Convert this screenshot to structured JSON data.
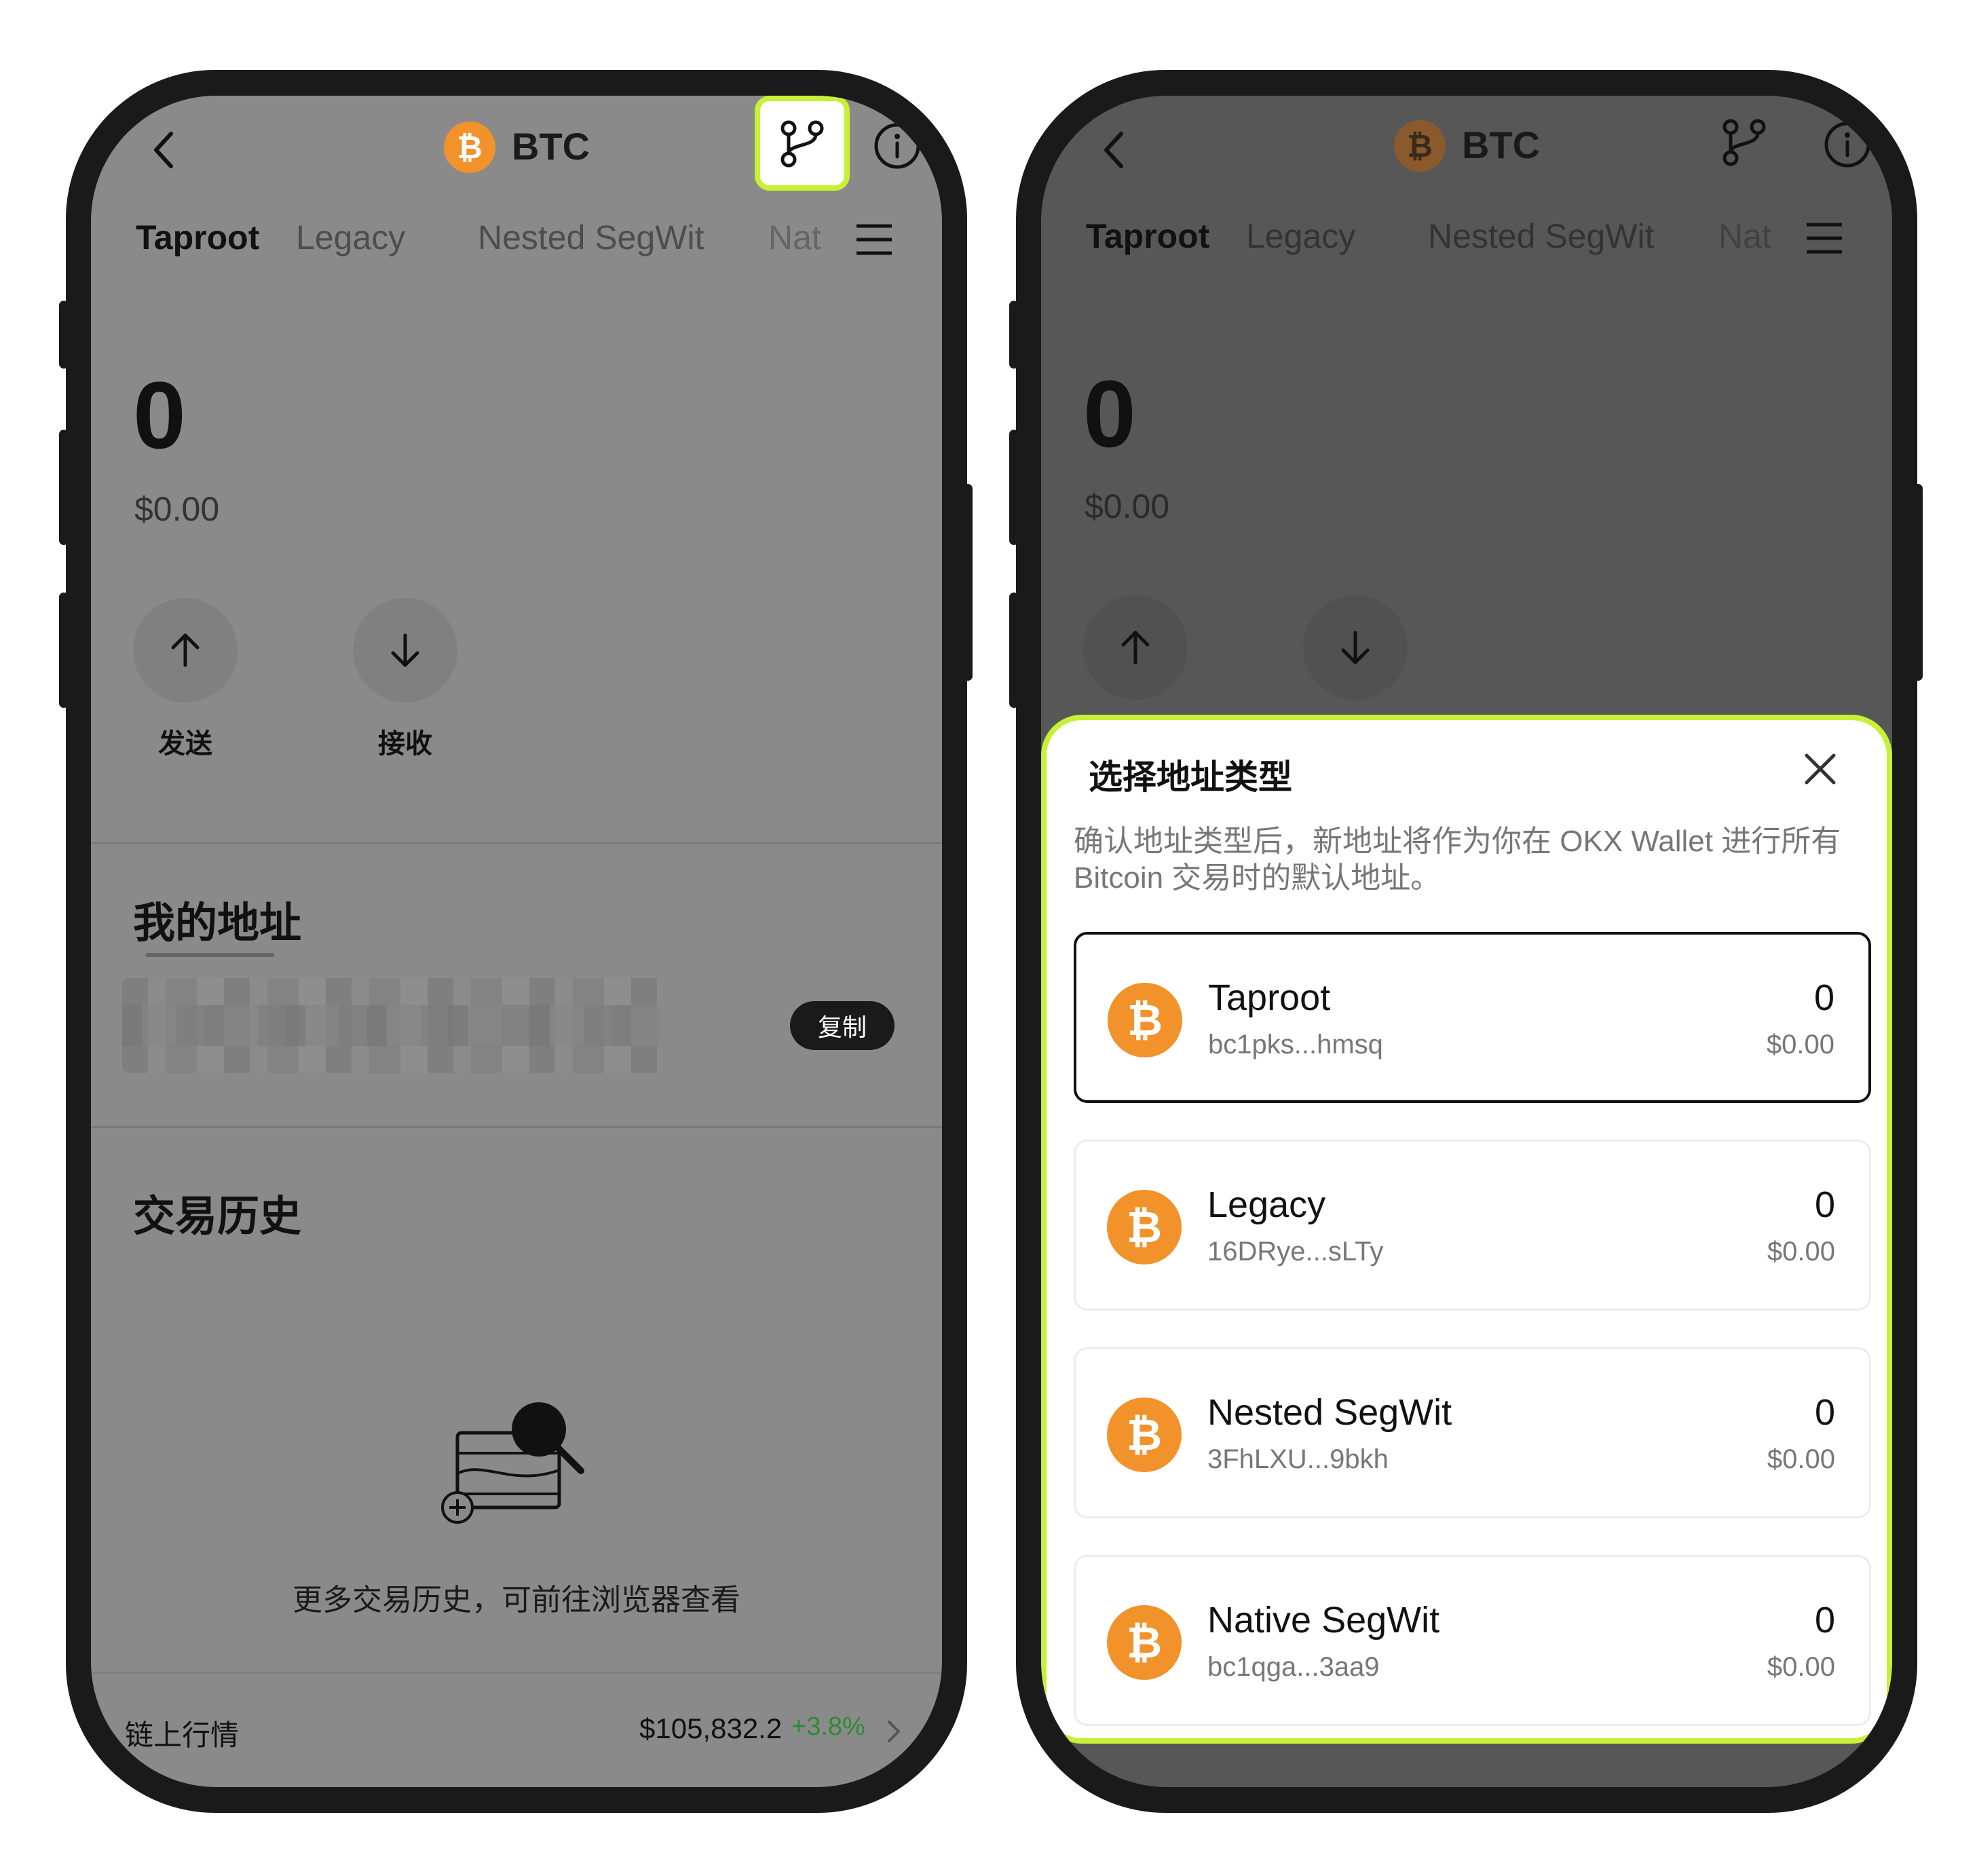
{
  "left": {
    "title": "BTC",
    "tabs": [
      "Taproot",
      "Legacy",
      "Nested SegWit",
      "Nat"
    ],
    "balance": "0",
    "fiat": "$0.00",
    "send_label": "发送",
    "receive_label": "接收",
    "my_address_title": "我的地址",
    "copy_label": "复制",
    "history_title": "交易历史",
    "empty_text": "更多交易历史，可前往浏览器查看",
    "market_label": "链上行情",
    "market_price": "$105,832.2",
    "market_change": "+3.8%",
    "change_color": "#2e8b2e",
    "highlight_color": "#c6f135"
  },
  "right": {
    "title": "BTC",
    "tabs": [
      "Taproot",
      "Legacy",
      "Nested SegWit",
      "Nat"
    ],
    "balance": "0",
    "fiat": "$0.00",
    "sheet": {
      "title": "选择地址类型",
      "description": "确认地址类型后，新地址将作为你在 OKX Wallet 进行所有 Bitcoin 交易时的默认地址。",
      "options": [
        {
          "name": "Taproot",
          "address": "bc1pks...hmsq",
          "balance": "0",
          "fiat": "$0.00"
        },
        {
          "name": "Legacy",
          "address": "16DRye...sLTy",
          "balance": "0",
          "fiat": "$0.00"
        },
        {
          "name": "Nested SegWit",
          "address": "3FhLXU...9bkh",
          "balance": "0",
          "fiat": "$0.00"
        },
        {
          "name": "Native SegWit",
          "address": "bc1qga...3aa9",
          "balance": "0",
          "fiat": "$0.00"
        }
      ]
    }
  },
  "icons": [
    "back-icon",
    "bitcoin-icon",
    "address-switch-icon",
    "info-icon",
    "menu-icon",
    "send-arrow-icon",
    "receive-arrow-icon",
    "empty-history-icon",
    "chevron-right-icon",
    "close-icon"
  ],
  "coin_color": "#f2922b"
}
